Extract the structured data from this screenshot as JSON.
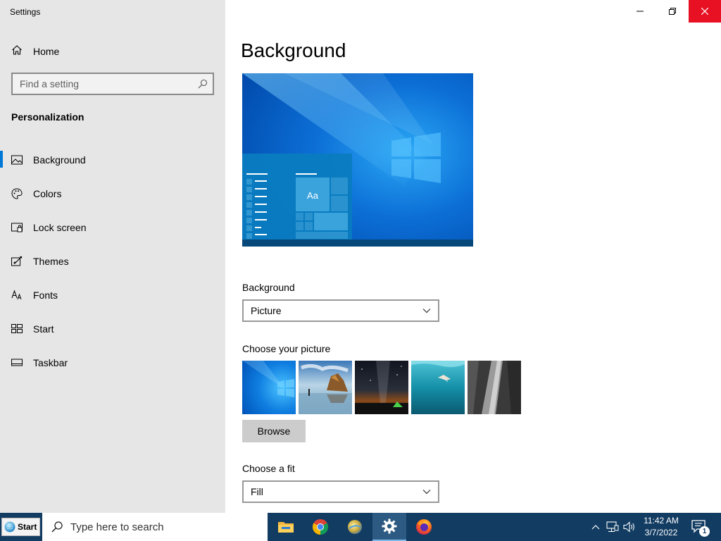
{
  "window": {
    "title": "Settings",
    "controls": {
      "minimize": "minimize",
      "maximize": "restore",
      "close": "close"
    },
    "close_color": "#e81123"
  },
  "sidebar": {
    "home_label": "Home",
    "search_placeholder": "Find a setting",
    "section_title": "Personalization",
    "accent": "#0078d7",
    "items": [
      {
        "label": "Background",
        "icon": "picture-icon",
        "active": true
      },
      {
        "label": "Colors",
        "icon": "palette-icon",
        "active": false
      },
      {
        "label": "Lock screen",
        "icon": "lock-screen-icon",
        "active": false
      },
      {
        "label": "Themes",
        "icon": "themes-icon",
        "active": false
      },
      {
        "label": "Fonts",
        "icon": "fonts-icon",
        "active": false
      },
      {
        "label": "Start",
        "icon": "start-icon",
        "active": false
      },
      {
        "label": "Taskbar",
        "icon": "taskbar-icon",
        "active": false
      }
    ]
  },
  "main": {
    "title": "Background",
    "preview": {
      "tile_text": "Aa"
    },
    "background_label": "Background",
    "background_value": "Picture",
    "choose_picture_label": "Choose your picture",
    "pictures": [
      {
        "name": "windows-blue"
      },
      {
        "name": "beach-rocks"
      },
      {
        "name": "night-sky-tent"
      },
      {
        "name": "underwater-swimmer"
      },
      {
        "name": "rock-cliff"
      }
    ],
    "browse_label": "Browse",
    "fit_label": "Choose a fit",
    "fit_value": "Fill"
  },
  "taskbar": {
    "start_label": "Start",
    "search_placeholder": "Type here to search",
    "apps": [
      {
        "name": "file-explorer",
        "active": false
      },
      {
        "name": "chrome",
        "active": false
      },
      {
        "name": "app-icon",
        "active": false
      },
      {
        "name": "settings",
        "active": true
      },
      {
        "name": "firefox",
        "active": false
      }
    ],
    "tray": [
      "chevron-up-icon",
      "network-icon",
      "volume-icon"
    ],
    "time": "11:42 AM",
    "date": "3/7/2022",
    "notification_count": "1",
    "background_color": "#123c62"
  }
}
